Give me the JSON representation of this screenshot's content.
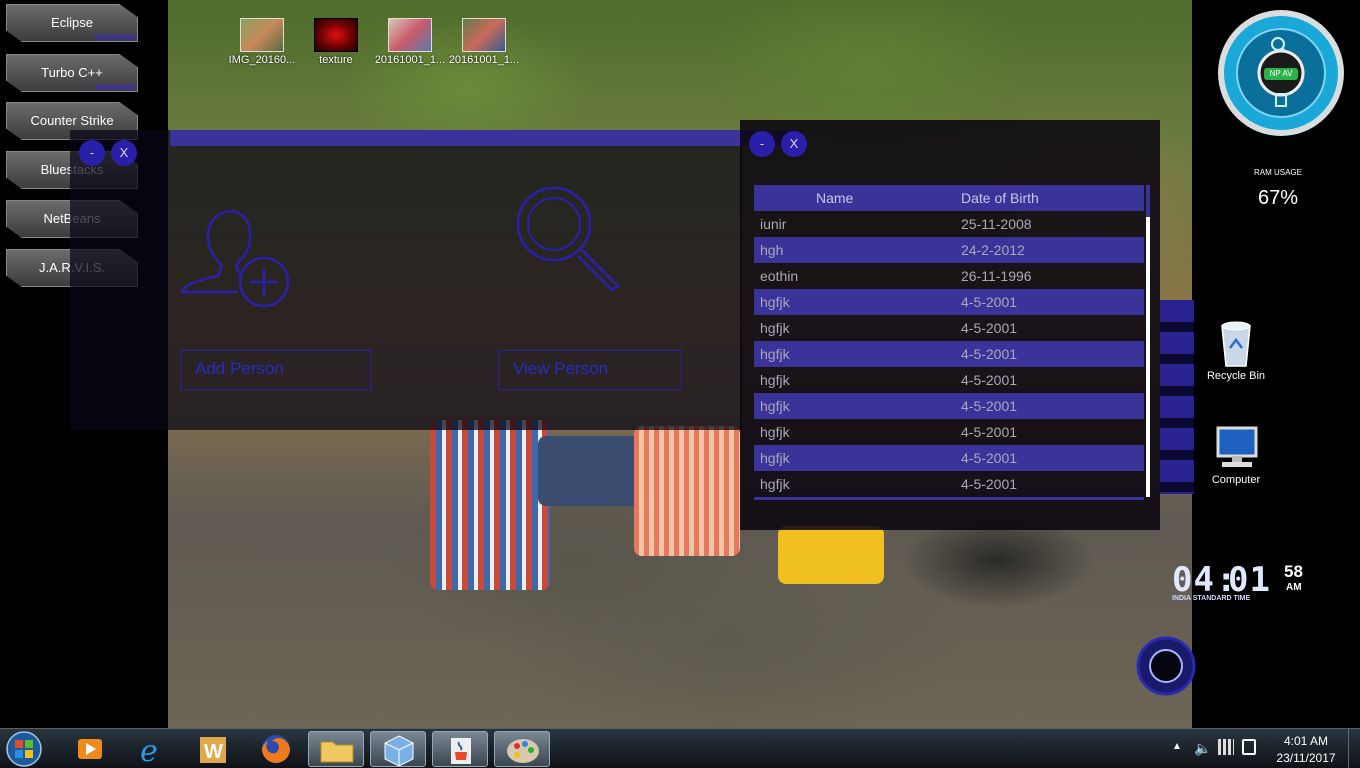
{
  "sidebar_apps": [
    {
      "label": "Eclipse"
    },
    {
      "label": "Turbo C++"
    },
    {
      "label": "Counter Strike"
    },
    {
      "label": "Bluestacks"
    },
    {
      "label": "NetBeans"
    },
    {
      "label": "J.A.R.V.I.S."
    }
  ],
  "desktop_icons": [
    {
      "label": "IMG_20160..."
    },
    {
      "label": "texture"
    },
    {
      "label": "20161001_1..."
    },
    {
      "label": "20161001_1..."
    }
  ],
  "add_panel": {
    "minimize_label": "-",
    "close_label": "X",
    "add_person_label": "Add Person",
    "view_person_label": "View Person"
  },
  "list_panel": {
    "minimize_label": "-",
    "close_label": "X",
    "columns": [
      "Name",
      "Date of Birth"
    ],
    "rows": [
      [
        "iunir",
        "25-11-2008"
      ],
      [
        "hgh",
        "24-2-2012"
      ],
      [
        "eothin",
        "26-11-1996"
      ],
      [
        "hgfjk",
        "4-5-2001"
      ],
      [
        "hgfjk",
        "4-5-2001"
      ],
      [
        "hgfjk",
        "4-5-2001"
      ],
      [
        "hgfjk",
        "4-5-2001"
      ],
      [
        "hgfjk",
        "4-5-2001"
      ],
      [
        "hgfjk",
        "4-5-2001"
      ],
      [
        "hgfjk",
        "4-5-2001"
      ],
      [
        "hgfjk",
        "4-5-2001"
      ]
    ]
  },
  "right_widgets": {
    "antivirus_badge": "NP AV",
    "ram_label": "RAM USAGE",
    "ram_value": "67%",
    "recycle_bin_label": "Recycle Bin",
    "computer_label": "Computer",
    "clock_hours": "04",
    "clock_minutes": "01",
    "clock_seconds": "58",
    "clock_ampm": "AM",
    "clock_zone": "INDIA STANDARD TIME"
  },
  "taskbar": {
    "items": [
      "start-orb",
      "media-player",
      "internet-explorer",
      "word",
      "firefox",
      "file-explorer",
      "virtualbox",
      "java",
      "paint"
    ],
    "time": "4:01 AM",
    "date": "23/11/2017"
  }
}
